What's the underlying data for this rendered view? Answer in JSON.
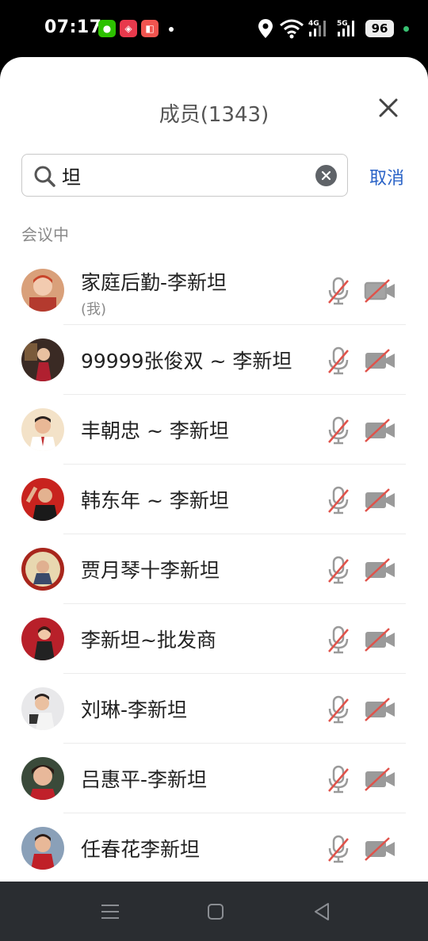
{
  "status_bar": {
    "time": "07:17",
    "battery": "96",
    "network_labels": [
      "4G",
      "5G"
    ],
    "app_icons": [
      "wechat-icon",
      "bilibili-icon",
      "meituan-icon"
    ]
  },
  "header": {
    "title": "成员(1343)"
  },
  "search": {
    "value": "坦",
    "cancel_label": "取消"
  },
  "section": {
    "label": "会议中"
  },
  "members": [
    {
      "name": "家庭后勤-李新坦",
      "sub": "(我)",
      "mic_muted": true,
      "camera_off": true
    },
    {
      "name": "99999张俊双 ~ 李新坦",
      "sub": "",
      "mic_muted": true,
      "camera_off": true
    },
    {
      "name": "丰朝忠 ~ 李新坦",
      "sub": "",
      "mic_muted": true,
      "camera_off": true
    },
    {
      "name": "韩东年 ~ 李新坦",
      "sub": "",
      "mic_muted": true,
      "camera_off": true
    },
    {
      "name": "贾月琴十李新坦",
      "sub": "",
      "mic_muted": true,
      "camera_off": true
    },
    {
      "name": "李新坦~批发商",
      "sub": "",
      "mic_muted": true,
      "camera_off": true
    },
    {
      "name": "刘琳-李新坦",
      "sub": "",
      "mic_muted": true,
      "camera_off": true
    },
    {
      "name": "吕惠平-李新坦",
      "sub": "",
      "mic_muted": true,
      "camera_off": true
    },
    {
      "name": "任春花李新坦",
      "sub": "",
      "mic_muted": true,
      "camera_off": true
    }
  ],
  "colors": {
    "accent": "#2a63c7",
    "muted_slash": "#e0524a",
    "icon_gray": "#9a9a9a"
  }
}
